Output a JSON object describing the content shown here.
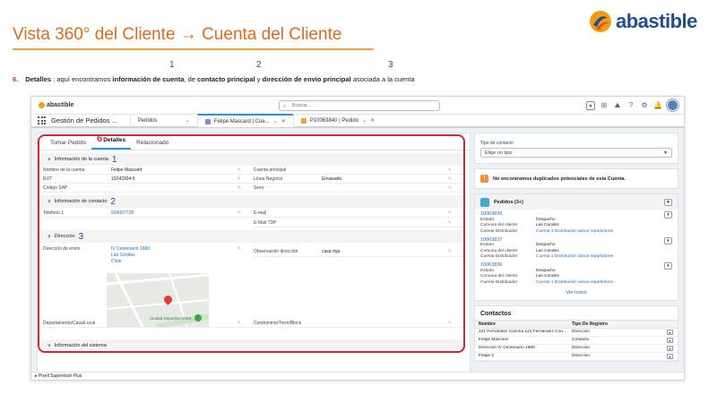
{
  "slide": {
    "title": "Vista 360° del Cliente → Cuenta del Cliente",
    "logo_text": "abastible",
    "markers": [
      "1",
      "2",
      "3"
    ],
    "desc_num": "6.",
    "desc_parts": [
      "Detalles",
      " : aquí encontramos ",
      "información de cuenta",
      ", de ",
      "contacto principal",
      " y ",
      "dirección de envío principal",
      " asociada a la cuenta"
    ]
  },
  "app": {
    "brand": "abastible",
    "search_placeholder": "Buscar...",
    "app_name": "Gestión de Pedidos ...",
    "nav_tabs": [
      {
        "label": "Pedidos"
      },
      {
        "label": "Felipe Mascard | Cue..."
      },
      {
        "label": "P10063840 | Pedido"
      }
    ],
    "record_tabs": {
      "six": "6",
      "tomar": "Tomar Pedido",
      "detalles": "Detalles",
      "relacionado": "Relacionado"
    },
    "sections": {
      "info": {
        "title": "Información de la cuenta",
        "num": "1"
      },
      "contact": {
        "title": "Información de contacto",
        "num": "2"
      },
      "address": {
        "title": "Dirección",
        "num": "3"
      },
      "system": {
        "title": "Información del sistema"
      }
    },
    "fields": {
      "nombre_label": "Nombre de la cuenta",
      "nombre_value": "Felipe Mascard",
      "cuenta_principal_label": "Cuenta principal",
      "rut_label": "RUT",
      "rut_value": "19243304-5",
      "linea_label": "Línea Negocio",
      "linea_value": "Envasado",
      "sap_label": "Código SAP",
      "sexo_label": "Sexo",
      "tel_label": "Teléfono 1",
      "tel_value": "934067728",
      "email_label": "E-mail",
      "emailtdp_label": "E-Mail TDP",
      "dir_label": "Dirección de envío",
      "dir_lines": [
        "IV Centenario 1680",
        "Las Condes",
        "Chile"
      ],
      "obs_label": "Observación dirección",
      "obs_value": "casa roja",
      "depto_label": "Departamento/Casa/Local",
      "condo_label": "Condominio/Torre/Block",
      "map_label": "Ciudad Deportiva IRSS"
    },
    "right": {
      "tipo_label": "Tipo de contacto",
      "tipo_value": "Elige un tipo",
      "dup_msg": "No encontramos duplicados potenciales de esta Cuenta.",
      "pedidos_title": "Pedidos (3+)",
      "pedidos": [
        {
          "id": "10063838",
          "estado": "Despacho",
          "comuna": "Las Condes",
          "dist": "Cuenta 1 Distribuidor varios repartidores"
        },
        {
          "id": "10063837",
          "estado": "Despacho",
          "comuna": "Las Condes",
          "dist": "Cuenta 1 Distribuidor varios repartidores"
        },
        {
          "id": "10063836",
          "estado": "Despacho",
          "comuna": "Las Condes",
          "dist": "Cuenta 1 Distribuidor varios repartidores"
        }
      ],
      "lbl_estado": "Estado:",
      "lbl_comuna": "Comuna del cliente:",
      "lbl_dist": "Cuenta Distribuidor:",
      "see_all": "Ver todos",
      "contactos_title": "Contactos",
      "col_nombre": "Nombre",
      "col_tipo": "Tipo De Registro",
      "contactos": [
        {
          "nombre": "121 Fernández Concha 121 Fernández Con...",
          "tipo": "Direccion"
        },
        {
          "nombre": "Felipe Mascard",
          "tipo": "Contacto"
        },
        {
          "nombre": "Dirección IV Centenario 1680",
          "tipo": "Direccion"
        },
        {
          "nombre": "Felipe 2",
          "tipo": "Direccion"
        }
      ]
    },
    "footer": "Pixell Supervisor Plus"
  },
  "colors": {
    "accent": "#e06a1a",
    "highlight": "#d0283a",
    "link": "#1b6ec2",
    "brand_blue": "#1f4f8f"
  }
}
